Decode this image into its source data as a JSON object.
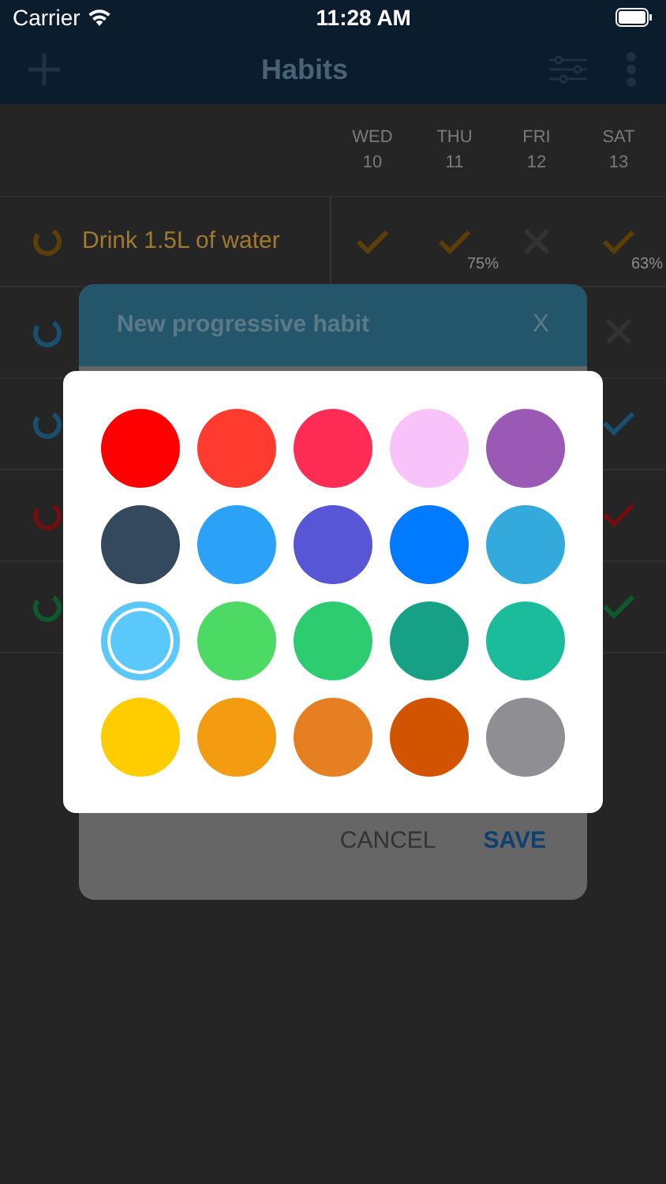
{
  "status_bar": {
    "carrier": "Carrier",
    "time": "11:28 AM"
  },
  "nav": {
    "title": "Habits"
  },
  "days": [
    {
      "name": "WED",
      "date": "10"
    },
    {
      "name": "THU",
      "date": "11"
    },
    {
      "name": "FRI",
      "date": "12"
    },
    {
      "name": "SAT",
      "date": "13"
    }
  ],
  "habits": [
    {
      "name": "Drink 1.5L of water",
      "color": "#5c3f06",
      "days": [
        {
          "done": true
        },
        {
          "done": true,
          "percent": "75%"
        },
        {
          "done": false
        },
        {
          "done": true,
          "percent": "63%"
        }
      ]
    },
    {
      "color": "#1b4f6e",
      "days": [
        {
          "done": false
        }
      ]
    },
    {
      "color": "#1b4f6e",
      "days": [
        {
          "done": true
        }
      ]
    },
    {
      "color": "#6e0f10",
      "days": [
        {
          "done": true
        }
      ]
    },
    {
      "color": "#0f5a2a",
      "days": [
        {
          "done": true
        }
      ]
    }
  ],
  "dialog": {
    "title": "New progressive habit",
    "close": "X",
    "buttons": [
      {
        "label": "CANCEL",
        "primary": false
      },
      {
        "label": "SAVE",
        "primary": true
      }
    ]
  },
  "color_picker": {
    "swatches": [
      {
        "color": "#ff0000",
        "selected": false
      },
      {
        "color": "#ff3b30",
        "selected": false
      },
      {
        "color": "#ff2d55",
        "selected": false
      },
      {
        "color": "#f8c3fb",
        "selected": false
      },
      {
        "color": "#9b59b6",
        "selected": false
      },
      {
        "color": "#34495e",
        "selected": false
      },
      {
        "color": "#2ba1f8",
        "selected": false
      },
      {
        "color": "#5856d6",
        "selected": false
      },
      {
        "color": "#007aff",
        "selected": false
      },
      {
        "color": "#34aadc",
        "selected": false
      },
      {
        "color": "#5ac8fa",
        "selected": true
      },
      {
        "color": "#4cd964",
        "selected": false
      },
      {
        "color": "#2ecc71",
        "selected": false
      },
      {
        "color": "#16a085",
        "selected": false
      },
      {
        "color": "#1abc9c",
        "selected": false
      },
      {
        "color": "#ffcc00",
        "selected": false
      },
      {
        "color": "#f39c12",
        "selected": false
      },
      {
        "color": "#e67e22",
        "selected": false
      },
      {
        "color": "#d35400",
        "selected": false
      },
      {
        "color": "#8e8e93",
        "selected": false
      }
    ]
  }
}
